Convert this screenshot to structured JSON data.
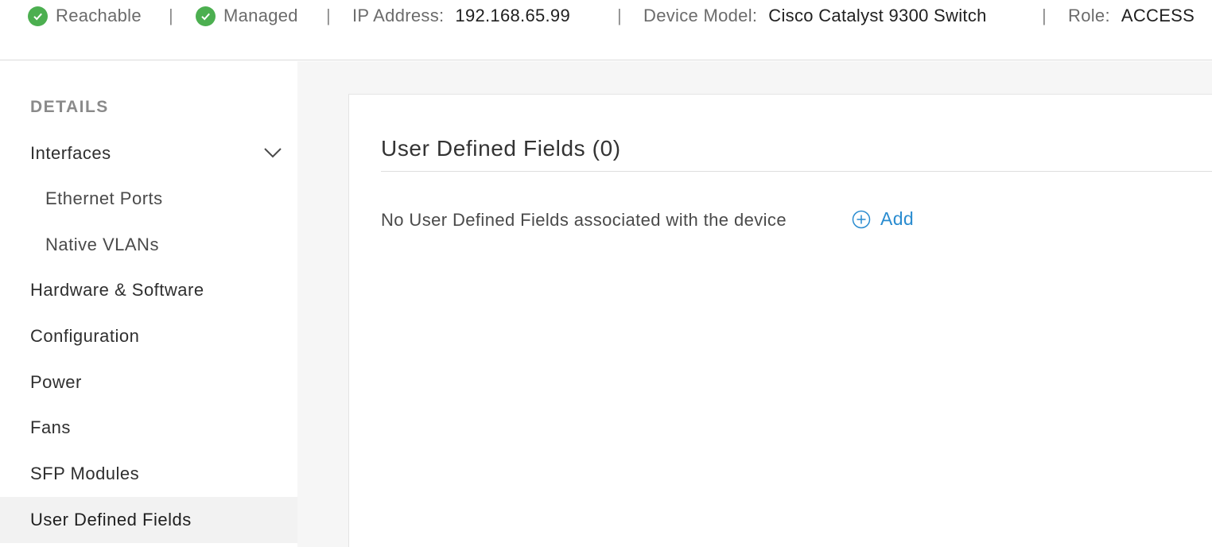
{
  "status_bar": {
    "reachable": "Reachable",
    "managed": "Managed",
    "ip_label": "IP Address:",
    "ip_value": "192.168.65.99",
    "model_label": "Device Model:",
    "model_value": "Cisco Catalyst 9300 Switch",
    "role_label": "Role:",
    "role_value": "ACCESS",
    "separator": "|",
    "status_color": "#4caf50"
  },
  "sidebar": {
    "heading": "DETAILS",
    "items": [
      {
        "label": "Interfaces",
        "icon": "chevron-down-icon"
      },
      {
        "label": "Ethernet Ports"
      },
      {
        "label": "Native VLANs"
      },
      {
        "label": "Hardware & Software"
      },
      {
        "label": "Configuration"
      },
      {
        "label": "Power"
      },
      {
        "label": "Fans"
      },
      {
        "label": "SFP Modules"
      },
      {
        "label": "User Defined Fields",
        "active": true
      }
    ]
  },
  "main": {
    "title": "User Defined Fields (0)",
    "empty_message": "No User Defined Fields associated with the device",
    "add_label": "Add",
    "accent_color": "#2a8cd0"
  }
}
